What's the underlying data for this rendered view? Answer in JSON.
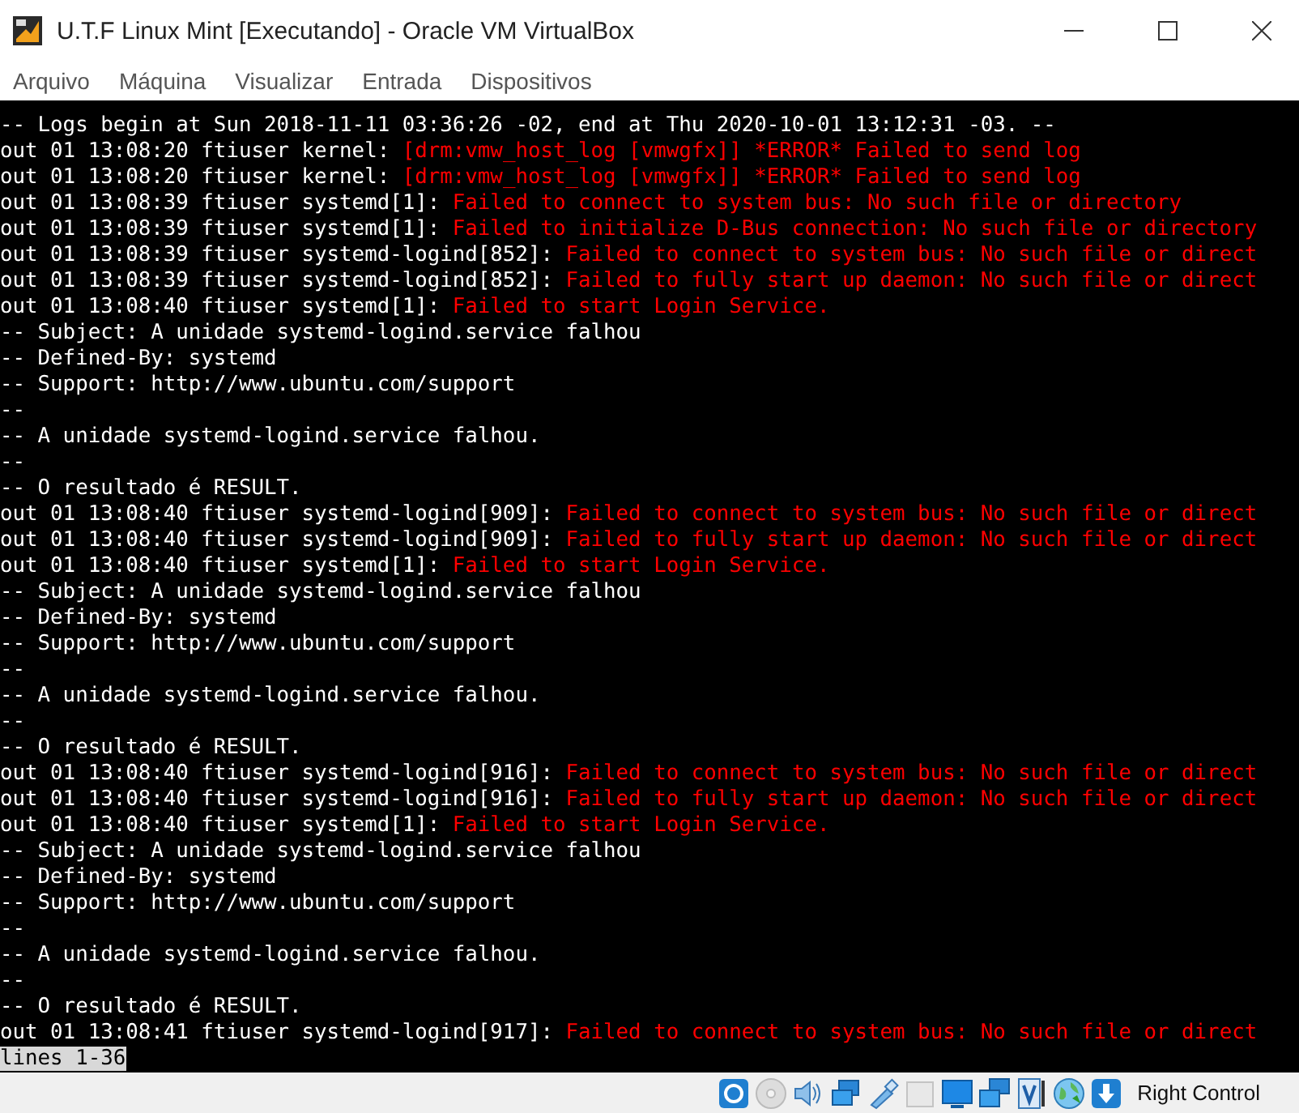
{
  "window": {
    "title": "U.T.F Linux Mint [Executando] - Oracle VM VirtualBox"
  },
  "menu": [
    "Arquivo",
    "Máquina",
    "Visualizar",
    "Entrada",
    "Dispositivos"
  ],
  "terminal": {
    "lines": [
      {
        "text": "-- Logs begin at Sun 2018-11-11 03:36:26 -02, end at Thu 2020-10-01 13:12:31 -03. --"
      },
      {
        "text": "out 01 13:08:20 ftiuser kernel: ",
        "error": "[drm:vmw_host_log [vmwgfx]] *ERROR* Failed to send log"
      },
      {
        "text": "out 01 13:08:20 ftiuser kernel: ",
        "error": "[drm:vmw_host_log [vmwgfx]] *ERROR* Failed to send log"
      },
      {
        "text": "out 01 13:08:39 ftiuser systemd[1]: ",
        "error": "Failed to connect to system bus: No such file or directory"
      },
      {
        "text": "out 01 13:08:39 ftiuser systemd[1]: ",
        "error": "Failed to initialize D-Bus connection: No such file or directory"
      },
      {
        "text": "out 01 13:08:39 ftiuser systemd-logind[852]: ",
        "error": "Failed to connect to system bus: No such file or direct"
      },
      {
        "text": "out 01 13:08:39 ftiuser systemd-logind[852]: ",
        "error": "Failed to fully start up daemon: No such file or direct"
      },
      {
        "text": "out 01 13:08:40 ftiuser systemd[1]: ",
        "error": "Failed to start Login Service."
      },
      {
        "text": "-- Subject: A unidade systemd-logind.service falhou"
      },
      {
        "text": "-- Defined-By: systemd"
      },
      {
        "text": "-- Support: http://www.ubuntu.com/support"
      },
      {
        "text": "--"
      },
      {
        "text": "-- A unidade systemd-logind.service falhou."
      },
      {
        "text": "--"
      },
      {
        "text": "-- O resultado é RESULT."
      },
      {
        "text": "out 01 13:08:40 ftiuser systemd-logind[909]: ",
        "error": "Failed to connect to system bus: No such file or direct"
      },
      {
        "text": "out 01 13:08:40 ftiuser systemd-logind[909]: ",
        "error": "Failed to fully start up daemon: No such file or direct"
      },
      {
        "text": "out 01 13:08:40 ftiuser systemd[1]: ",
        "error": "Failed to start Login Service."
      },
      {
        "text": "-- Subject: A unidade systemd-logind.service falhou"
      },
      {
        "text": "-- Defined-By: systemd"
      },
      {
        "text": "-- Support: http://www.ubuntu.com/support"
      },
      {
        "text": "--"
      },
      {
        "text": "-- A unidade systemd-logind.service falhou."
      },
      {
        "text": "--"
      },
      {
        "text": "-- O resultado é RESULT."
      },
      {
        "text": "out 01 13:08:40 ftiuser systemd-logind[916]: ",
        "error": "Failed to connect to system bus: No such file or direct"
      },
      {
        "text": "out 01 13:08:40 ftiuser systemd-logind[916]: ",
        "error": "Failed to fully start up daemon: No such file or direct"
      },
      {
        "text": "out 01 13:08:40 ftiuser systemd[1]: ",
        "error": "Failed to start Login Service."
      },
      {
        "text": "-- Subject: A unidade systemd-logind.service falhou"
      },
      {
        "text": "-- Defined-By: systemd"
      },
      {
        "text": "-- Support: http://www.ubuntu.com/support"
      },
      {
        "text": "--"
      },
      {
        "text": "-- A unidade systemd-logind.service falhou."
      },
      {
        "text": "--"
      },
      {
        "text": "-- O resultado é RESULT."
      },
      {
        "text": "out 01 13:08:41 ftiuser systemd-logind[917]: ",
        "error": "Failed to connect to system bus: No such file or direct"
      }
    ],
    "pager_status": "lines 1-36"
  },
  "status_bar": {
    "host_key": "Right Control"
  }
}
